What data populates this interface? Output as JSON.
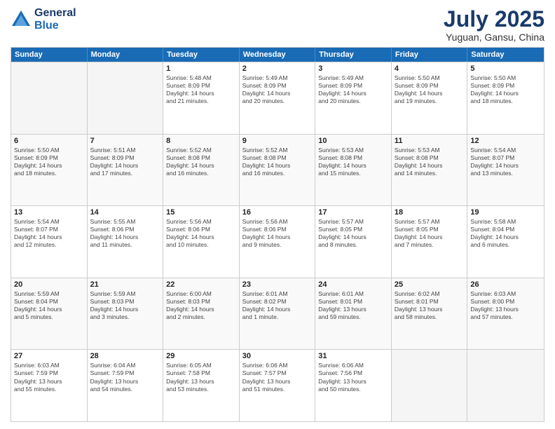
{
  "logo": {
    "line1": "General",
    "line2": "Blue"
  },
  "header": {
    "title": "July 2025",
    "subtitle": "Yuguan, Gansu, China"
  },
  "weekdays": [
    "Sunday",
    "Monday",
    "Tuesday",
    "Wednesday",
    "Thursday",
    "Friday",
    "Saturday"
  ],
  "rows": [
    [
      {
        "day": "",
        "info": ""
      },
      {
        "day": "",
        "info": ""
      },
      {
        "day": "1",
        "info": "Sunrise: 5:48 AM\nSunset: 8:09 PM\nDaylight: 14 hours\nand 21 minutes."
      },
      {
        "day": "2",
        "info": "Sunrise: 5:49 AM\nSunset: 8:09 PM\nDaylight: 14 hours\nand 20 minutes."
      },
      {
        "day": "3",
        "info": "Sunrise: 5:49 AM\nSunset: 8:09 PM\nDaylight: 14 hours\nand 20 minutes."
      },
      {
        "day": "4",
        "info": "Sunrise: 5:50 AM\nSunset: 8:09 PM\nDaylight: 14 hours\nand 19 minutes."
      },
      {
        "day": "5",
        "info": "Sunrise: 5:50 AM\nSunset: 8:09 PM\nDaylight: 14 hours\nand 18 minutes."
      }
    ],
    [
      {
        "day": "6",
        "info": "Sunrise: 5:50 AM\nSunset: 8:09 PM\nDaylight: 14 hours\nand 18 minutes."
      },
      {
        "day": "7",
        "info": "Sunrise: 5:51 AM\nSunset: 8:09 PM\nDaylight: 14 hours\nand 17 minutes."
      },
      {
        "day": "8",
        "info": "Sunrise: 5:52 AM\nSunset: 8:08 PM\nDaylight: 14 hours\nand 16 minutes."
      },
      {
        "day": "9",
        "info": "Sunrise: 5:52 AM\nSunset: 8:08 PM\nDaylight: 14 hours\nand 16 minutes."
      },
      {
        "day": "10",
        "info": "Sunrise: 5:53 AM\nSunset: 8:08 PM\nDaylight: 14 hours\nand 15 minutes."
      },
      {
        "day": "11",
        "info": "Sunrise: 5:53 AM\nSunset: 8:08 PM\nDaylight: 14 hours\nand 14 minutes."
      },
      {
        "day": "12",
        "info": "Sunrise: 5:54 AM\nSunset: 8:07 PM\nDaylight: 14 hours\nand 13 minutes."
      }
    ],
    [
      {
        "day": "13",
        "info": "Sunrise: 5:54 AM\nSunset: 8:07 PM\nDaylight: 14 hours\nand 12 minutes."
      },
      {
        "day": "14",
        "info": "Sunrise: 5:55 AM\nSunset: 8:06 PM\nDaylight: 14 hours\nand 11 minutes."
      },
      {
        "day": "15",
        "info": "Sunrise: 5:56 AM\nSunset: 8:06 PM\nDaylight: 14 hours\nand 10 minutes."
      },
      {
        "day": "16",
        "info": "Sunrise: 5:56 AM\nSunset: 8:06 PM\nDaylight: 14 hours\nand 9 minutes."
      },
      {
        "day": "17",
        "info": "Sunrise: 5:57 AM\nSunset: 8:05 PM\nDaylight: 14 hours\nand 8 minutes."
      },
      {
        "day": "18",
        "info": "Sunrise: 5:57 AM\nSunset: 8:05 PM\nDaylight: 14 hours\nand 7 minutes."
      },
      {
        "day": "19",
        "info": "Sunrise: 5:58 AM\nSunset: 8:04 PM\nDaylight: 14 hours\nand 6 minutes."
      }
    ],
    [
      {
        "day": "20",
        "info": "Sunrise: 5:59 AM\nSunset: 8:04 PM\nDaylight: 14 hours\nand 5 minutes."
      },
      {
        "day": "21",
        "info": "Sunrise: 5:59 AM\nSunset: 8:03 PM\nDaylight: 14 hours\nand 3 minutes."
      },
      {
        "day": "22",
        "info": "Sunrise: 6:00 AM\nSunset: 8:03 PM\nDaylight: 14 hours\nand 2 minutes."
      },
      {
        "day": "23",
        "info": "Sunrise: 6:01 AM\nSunset: 8:02 PM\nDaylight: 14 hours\nand 1 minute."
      },
      {
        "day": "24",
        "info": "Sunrise: 6:01 AM\nSunset: 8:01 PM\nDaylight: 13 hours\nand 59 minutes."
      },
      {
        "day": "25",
        "info": "Sunrise: 6:02 AM\nSunset: 8:01 PM\nDaylight: 13 hours\nand 58 minutes."
      },
      {
        "day": "26",
        "info": "Sunrise: 6:03 AM\nSunset: 8:00 PM\nDaylight: 13 hours\nand 57 minutes."
      }
    ],
    [
      {
        "day": "27",
        "info": "Sunrise: 6:03 AM\nSunset: 7:59 PM\nDaylight: 13 hours\nand 55 minutes."
      },
      {
        "day": "28",
        "info": "Sunrise: 6:04 AM\nSunset: 7:59 PM\nDaylight: 13 hours\nand 54 minutes."
      },
      {
        "day": "29",
        "info": "Sunrise: 6:05 AM\nSunset: 7:58 PM\nDaylight: 13 hours\nand 53 minutes."
      },
      {
        "day": "30",
        "info": "Sunrise: 6:06 AM\nSunset: 7:57 PM\nDaylight: 13 hours\nand 51 minutes."
      },
      {
        "day": "31",
        "info": "Sunrise: 6:06 AM\nSunset: 7:56 PM\nDaylight: 13 hours\nand 50 minutes."
      },
      {
        "day": "",
        "info": ""
      },
      {
        "day": "",
        "info": ""
      }
    ]
  ]
}
